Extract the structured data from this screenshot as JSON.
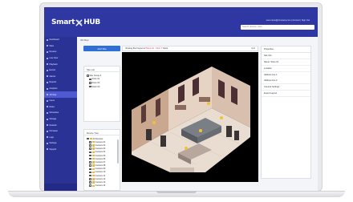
{
  "header": {
    "logo_left": "Smart",
    "logo_right": "HUB",
    "user_text": "user.name@company.com  |  Account  |  Sign Out",
    "search_placeholder": "Search devices, sites..."
  },
  "sidebar": {
    "items": [
      {
        "label": "Dashboard",
        "active": false
      },
      {
        "label": "Sites",
        "active": false
      },
      {
        "label": "Devices",
        "active": false
      },
      {
        "label": "Live View",
        "active": false
      },
      {
        "label": "Playback",
        "active": false
      },
      {
        "label": "Events",
        "active": false
      },
      {
        "label": "Alarms",
        "active": false
      },
      {
        "label": "Reports",
        "active": false
      },
      {
        "label": "Analytics",
        "active": false
      },
      {
        "label": "3D Map",
        "active": true
      },
      {
        "label": "Users",
        "active": false
      },
      {
        "label": "Roles",
        "active": false
      },
      {
        "label": "Schedules",
        "active": false
      },
      {
        "label": "Storage",
        "active": false
      },
      {
        "label": "Network",
        "active": false
      },
      {
        "label": "Firmware",
        "active": false
      },
      {
        "label": "Logs",
        "active": false
      },
      {
        "label": "Settings",
        "active": false
      },
      {
        "label": "Support",
        "active": false
      }
    ]
  },
  "breadcrumb": "3D Map",
  "left_panel": {
    "button_label": "Add Site",
    "tree_title": "Site List",
    "tree_items": [
      "Site Group A",
      "Store 01",
      "Store 02",
      "Store 03"
    ],
    "device_title": "Device Tree",
    "device_items": [
      "All Devices",
      "Camera 01",
      "Camera 02",
      "Camera 03",
      "Camera 04",
      "Camera 05",
      "Camera 06",
      "Camera 07",
      "Camera 08",
      "Camera 09",
      "Camera 10",
      "Camera 11",
      "Camera 12",
      "Camera 13",
      "Camera 14"
    ]
  },
  "viewer": {
    "label_prefix": "Viewing floor layout of",
    "label_highlight": "Store 01 - Floor 1",
    "label_suffix": "Store",
    "action_label": "Edit"
  },
  "right_panel": {
    "title": "Properties",
    "rows": [
      {
        "text": "Site Info",
        "type": "sec"
      },
      {
        "text": "Name: Store 01",
        "type": "sec"
      },
      {
        "text": "Location",
        "type": "sec"
      },
      {
        "text": "Address line 1",
        "type": "plain"
      },
      {
        "text": "Address line 2",
        "type": "sec"
      },
      {
        "text": "Camera Settings",
        "type": "sec"
      },
      {
        "text": "Export Layout",
        "type": "sec"
      }
    ]
  },
  "colors": {
    "header": "#2f37a3",
    "sidebar": "#2b3296",
    "accent": "#2f6fd6",
    "highlight": "#e23b3b"
  }
}
